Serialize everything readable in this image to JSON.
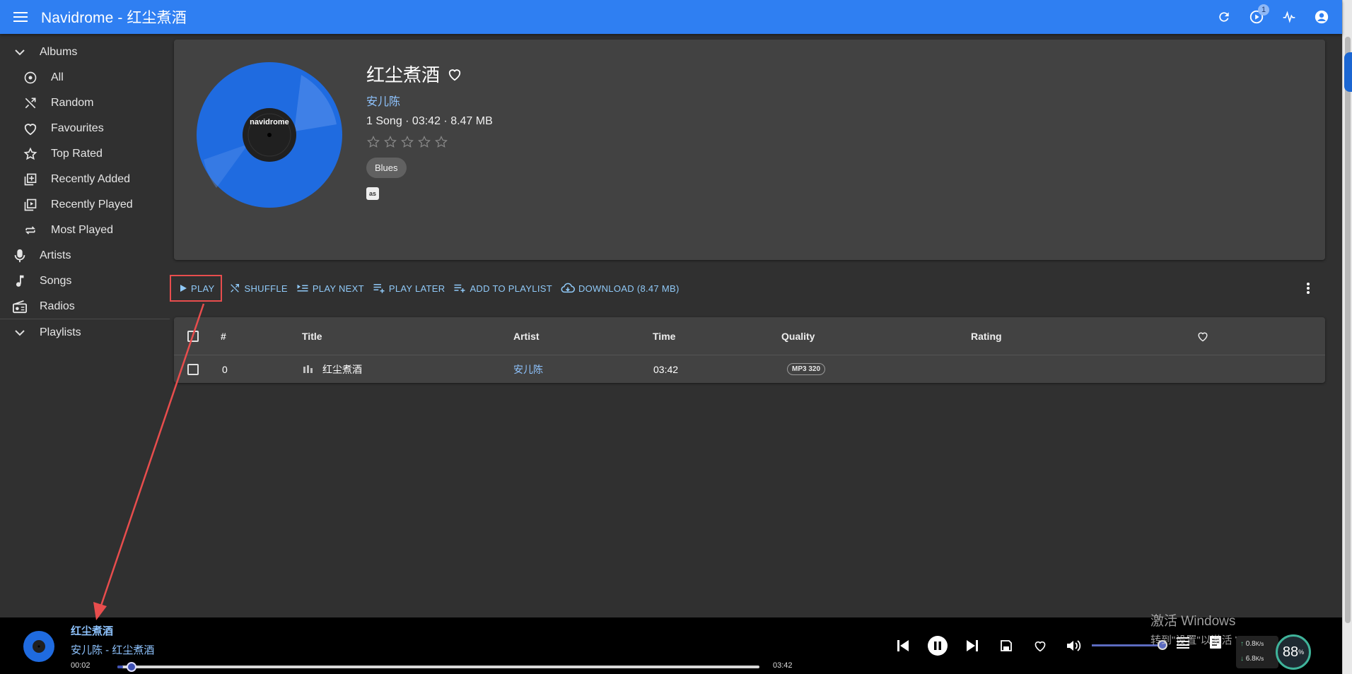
{
  "app": {
    "title": "Navidrome - 红尘煮酒",
    "brand_color": "#2f7ff2",
    "queue_badge": "1"
  },
  "sidebar": {
    "albums_label": "Albums",
    "album_items": [
      {
        "label": "All",
        "icon": "album-icon"
      },
      {
        "label": "Random",
        "icon": "shuffle-icon"
      },
      {
        "label": "Favourites",
        "icon": "heart-icon"
      },
      {
        "label": "Top Rated",
        "icon": "star-icon"
      },
      {
        "label": "Recently Added",
        "icon": "library-add-icon"
      },
      {
        "label": "Recently Played",
        "icon": "video-library-icon"
      },
      {
        "label": "Most Played",
        "icon": "repeat-icon"
      }
    ],
    "artists_label": "Artists",
    "songs_label": "Songs",
    "radios_label": "Radios",
    "playlists_label": "Playlists"
  },
  "album": {
    "title": "红尘煮酒",
    "artist": "安儿陈",
    "meta": "1 Song · 03:42 · 8.47 MB",
    "rating": 0,
    "genre": "Blues",
    "cover_text": "navidrome"
  },
  "actions": {
    "play": "Play",
    "shuffle": "Shuffle",
    "play_next": "Play Next",
    "play_later": "Play Later",
    "add_to_playlist": "Add to Playlist",
    "download": "Download (8.47 MB)"
  },
  "table": {
    "headers": {
      "number": "#",
      "title": "Title",
      "artist": "Artist",
      "time": "Time",
      "quality": "Quality",
      "rating": "Rating"
    },
    "rows": [
      {
        "number": "0",
        "title": "红尘煮酒",
        "artist": "安儿陈",
        "time": "03:42",
        "quality": "MP3 320"
      }
    ]
  },
  "player": {
    "title": "红尘煮酒",
    "subtitle": "安儿陈 - 红尘煮酒",
    "elapsed": "00:02",
    "duration": "03:42",
    "progress_fraction": 0.009,
    "volume_fraction": 0.93
  },
  "overlay": {
    "watermark_line1": "激活 Windows",
    "watermark_line2": "转到\"设置\"以激活 Windows。",
    "net_up": "0.8",
    "net_down": "6.8",
    "net_unit": "K/s",
    "gauge_value": "88",
    "gauge_unit": "%"
  }
}
